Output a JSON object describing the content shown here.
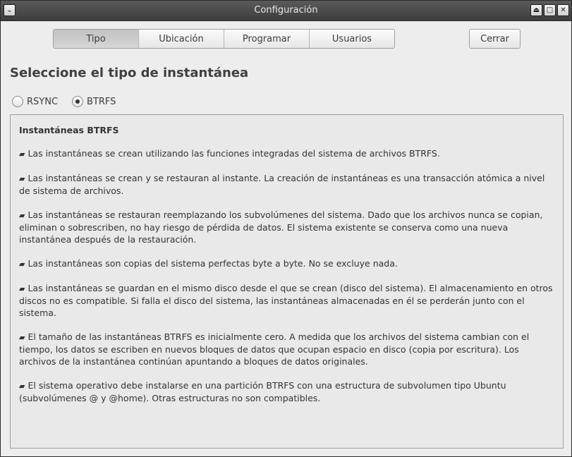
{
  "window": {
    "title": "Configuración"
  },
  "titlebar": {
    "menu_glyph": "⌄",
    "shade_glyph": "⏏",
    "maximize_glyph": "□",
    "close_glyph": "✕"
  },
  "tabs": [
    {
      "label": "Tipo",
      "active": true
    },
    {
      "label": "Ubicación",
      "active": false
    },
    {
      "label": "Programar",
      "active": false
    },
    {
      "label": "Usuarios",
      "active": false
    }
  ],
  "close_button": {
    "label": "Cerrar"
  },
  "heading": "Seleccione el tipo de instantánea",
  "radios": [
    {
      "label": "RSYNC",
      "checked": false
    },
    {
      "label": "BTRFS",
      "checked": true
    }
  ],
  "description": {
    "title": "Instantáneas BTRFS",
    "bullet_glyph": "▰",
    "paragraphs": [
      "Las instantáneas se crean utilizando las funciones integradas del sistema de archivos BTRFS.",
      "Las instantáneas se crean y se restauran al instante. La creación de instantáneas es una transacción atómica a nivel de sistema de archivos.",
      "Las instantáneas se restauran reemplazando los subvolúmenes del sistema. Dado que los archivos nunca se copian, eliminan o sobrescriben, no hay riesgo de pérdida de datos. El sistema existente se conserva como una nueva instantánea después de la restauración.",
      "Las instantáneas son copias del sistema perfectas byte a byte. No se excluye nada.",
      "Las instantáneas se guardan en el mismo disco desde el que se crean (disco del sistema). El almacenamiento en otros discos no es compatible. Si falla el disco del sistema, las instantáneas almacenadas en él se perderán junto con el sistema.",
      "El tamaño de las instantáneas BTRFS es inicialmente cero. A medida que los archivos del sistema cambian con el tiempo, los datos se escriben en nuevos bloques de datos que ocupan espacio en disco (copia por escritura). Los archivos de la instantánea continúan apuntando a bloques de datos originales.",
      "El sistema operativo debe instalarse en una partición BTRFS con una estructura de subvolumen tipo Ubuntu (subvolúmenes @ y @home). Otras estructuras no son compatibles."
    ]
  }
}
